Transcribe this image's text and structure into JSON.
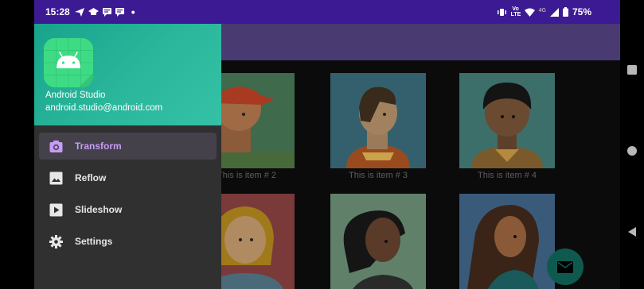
{
  "status_bar": {
    "time": "15:28",
    "battery": "75%"
  },
  "drawer": {
    "header": {
      "app_name": "Android Studio",
      "email": "android.studio@android.com"
    },
    "items": [
      {
        "label": "Transform",
        "icon": "camera-icon",
        "active": true
      },
      {
        "label": "Reflow",
        "icon": "image-icon",
        "active": false
      },
      {
        "label": "Slideshow",
        "icon": "slideshow-icon",
        "active": false
      },
      {
        "label": "Settings",
        "icon": "gear-icon",
        "active": false
      }
    ]
  },
  "grid": {
    "captions": [
      "This is item # 2",
      "This is item # 3",
      "This is item # 4"
    ]
  },
  "colors": {
    "accent": "#c69cf6",
    "status_bar": "#3c1a93",
    "app_bar": "#4a3a72",
    "header": "#2bb79b",
    "fab": "#0f5a4f"
  }
}
